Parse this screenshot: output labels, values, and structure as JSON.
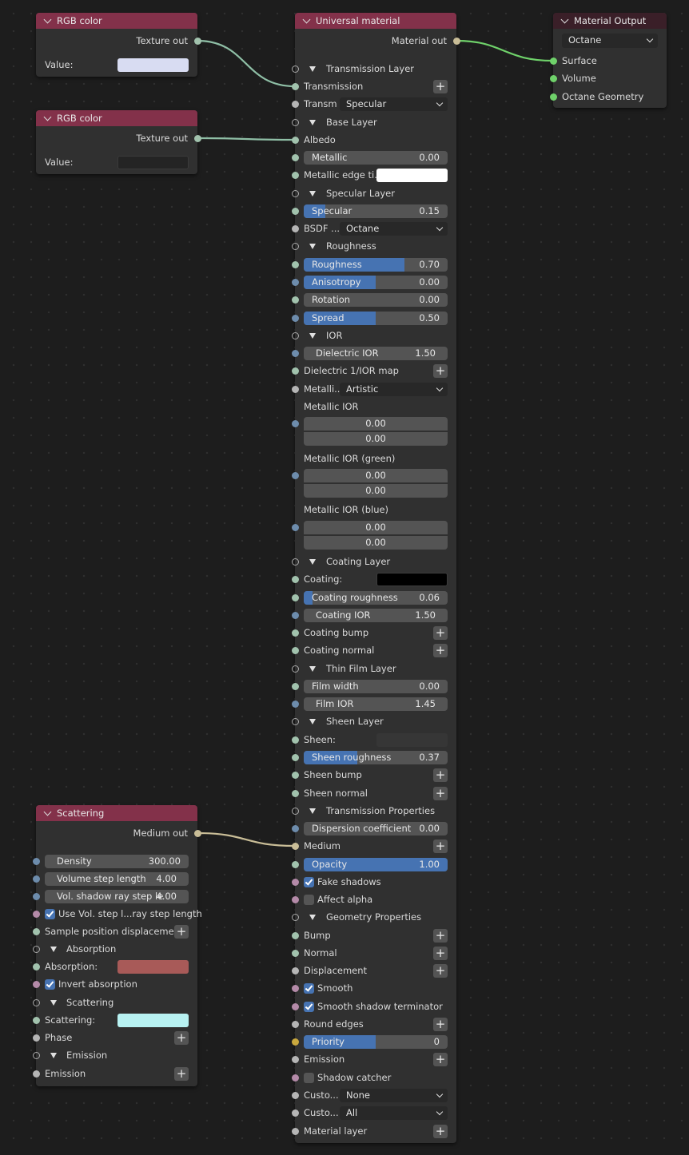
{
  "colors": {
    "header_red": "#83314a",
    "header_dark": "#3a1f28",
    "accent_blue": "#4673b2",
    "wire_green": "#6fd16a",
    "wire_teal": "#8fbfa6",
    "wire_tan": "#c9bd97"
  },
  "rgb1": {
    "title": "RGB color",
    "output": "Texture out",
    "value_label": "Value:",
    "swatch": "#d8dcf2"
  },
  "rgb2": {
    "title": "RGB color",
    "output": "Texture out",
    "value_label": "Value:",
    "swatch": "#242424"
  },
  "scattering": {
    "title": "Scattering",
    "output": "Medium out",
    "density": {
      "label": "Density",
      "value": "300.00"
    },
    "volume_step": {
      "label": "Volume step length",
      "value": "4.00"
    },
    "vol_shadow": {
      "label": "Vol. shadow ray step le",
      "value": "4.00"
    },
    "use_vol_step": "Use Vol. step l...ray step length",
    "sample_pos_disp": "Sample position displacement",
    "absorption_section": "Absorption",
    "absorption_label": "Absorption:",
    "absorption_color": "#a85a58",
    "invert_absorption": "Invert absorption",
    "scattering_section": "Scattering",
    "scattering_label": "Scattering:",
    "scattering_color": "#b8f2f2",
    "phase": "Phase",
    "emission_section": "Emission",
    "emission": "Emission"
  },
  "universal": {
    "title": "Universal material",
    "output": "Material out",
    "transmission_layer": "Transmission Layer",
    "transmission": "Transmission",
    "transm_label": "Transm",
    "transm_value": "Specular",
    "base_layer": "Base Layer",
    "albedo": "Albedo",
    "metallic": {
      "label": "Metallic",
      "value": "0.00"
    },
    "metallic_edge": "Metallic edge ti...",
    "specular_layer": "Specular Layer",
    "specular": {
      "label": "Specular",
      "value": "0.15",
      "fraction": 0.15
    },
    "bsdf_label": "BSDF ...",
    "bsdf_value": "Octane",
    "roughness_section": "Roughness",
    "roughness": {
      "label": "Roughness",
      "value": "0.70",
      "fraction": 0.7
    },
    "anisotropy": {
      "label": "Anisotropy",
      "value": "0.00",
      "fraction": 0.5
    },
    "rotation": {
      "label": "Rotation",
      "value": "0.00"
    },
    "spread": {
      "label": "Spread",
      "value": "0.50",
      "fraction": 0.5
    },
    "ior_section": "IOR",
    "dielectric_ior": {
      "label": "Dielectric IOR",
      "value": "1.50"
    },
    "dielectric_map": "Dielectric 1/IOR map",
    "metalli_label": "Metalli...",
    "metalli_value": "Artistic",
    "metallic_ior": "Metallic IOR",
    "metallic_ior_vals": [
      "0.00",
      "0.00"
    ],
    "metallic_ior_green": "Metallic IOR (green)",
    "metallic_ior_green_vals": [
      "0.00",
      "0.00"
    ],
    "metallic_ior_blue": "Metallic IOR (blue)",
    "metallic_ior_blue_vals": [
      "0.00",
      "0.00"
    ],
    "coating_layer": "Coating Layer",
    "coating": "Coating:",
    "coating_roughness": {
      "label": "Coating roughness",
      "value": "0.06",
      "fraction": 0.06
    },
    "coating_ior": {
      "label": "Coating IOR",
      "value": "1.50"
    },
    "coating_bump": "Coating bump",
    "coating_normal": "Coating normal",
    "thin_film_layer": "Thin Film Layer",
    "film_width": {
      "label": "Film width",
      "value": "0.00"
    },
    "film_ior": {
      "label": "Film IOR",
      "value": "1.45"
    },
    "sheen_layer": "Sheen Layer",
    "sheen": "Sheen:",
    "sheen_roughness": {
      "label": "Sheen roughness",
      "value": "0.37",
      "fraction": 0.37
    },
    "sheen_bump": "Sheen bump",
    "sheen_normal": "Sheen normal",
    "transmission_props": "Transmission Properties",
    "dispersion": {
      "label": "Dispersion coefficient",
      "value": "0.00"
    },
    "medium": "Medium",
    "opacity": {
      "label": "Opacity",
      "value": "1.00",
      "fraction": 1.0
    },
    "fake_shadows": "Fake shadows",
    "affect_alpha": "Affect alpha",
    "geometry_props": "Geometry Properties",
    "bump": "Bump",
    "normal": "Normal",
    "displacement": "Displacement",
    "smooth": "Smooth",
    "smooth_shadow": "Smooth shadow terminator",
    "round_edges": "Round edges",
    "priority": {
      "label": "Priority",
      "value": "0",
      "fraction": 0.5
    },
    "emission": "Emission",
    "shadow_catcher": "Shadow catcher",
    "custo1_label": "Custo...",
    "custo1_value": "None",
    "custo2_label": "Custo...",
    "custo2_value": "All",
    "material_layer": "Material layer"
  },
  "output_node": {
    "title": "Material Output",
    "renderer": "Octane",
    "surface": "Surface",
    "volume": "Volume",
    "geometry": "Octane Geometry"
  }
}
